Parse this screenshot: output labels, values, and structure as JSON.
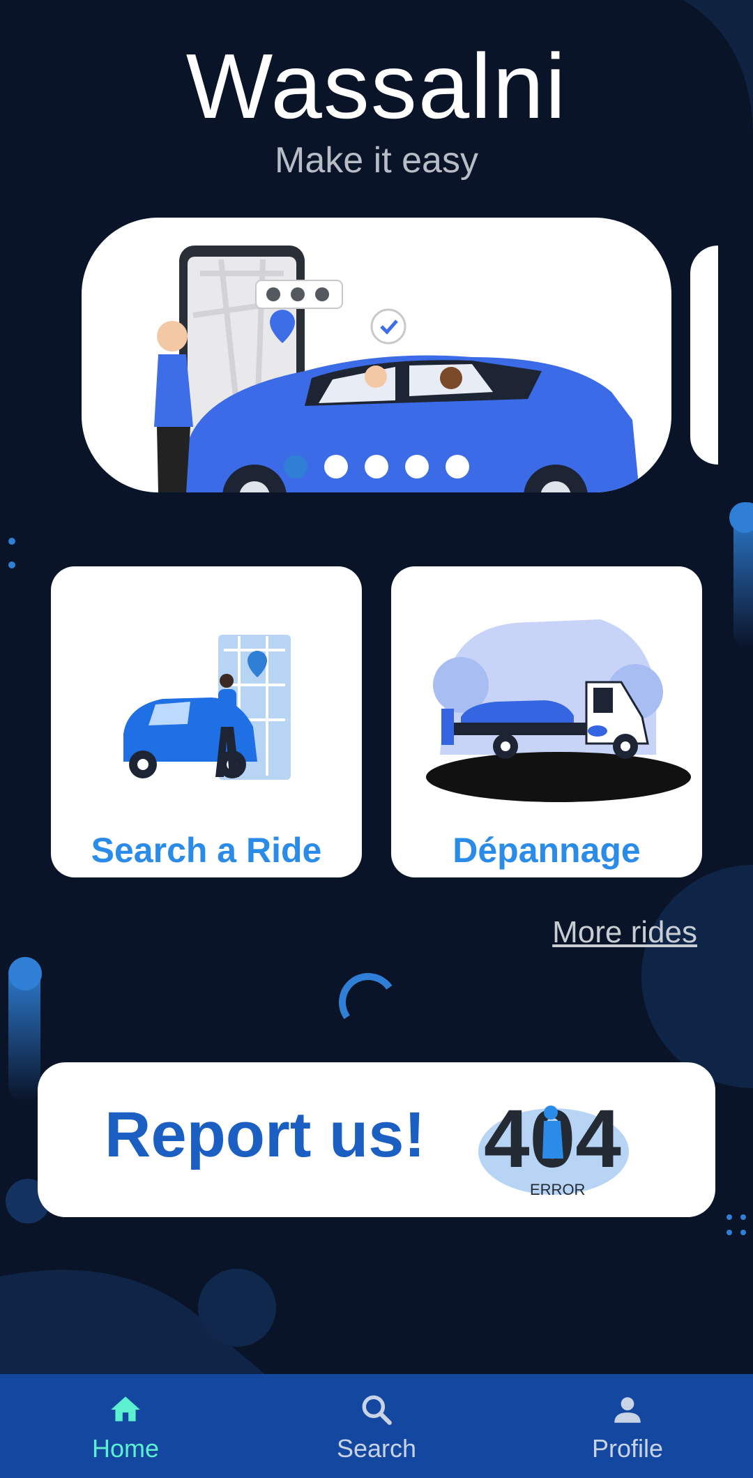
{
  "app": {
    "title": "Wassalni",
    "subtitle": "Make it easy"
  },
  "carousel": {
    "slide_count": 5,
    "active_index": 0
  },
  "services": [
    {
      "label": "Search a Ride"
    },
    {
      "label": "Dépannage"
    }
  ],
  "more_link": "More rides",
  "report": {
    "label": "Report us!",
    "badge_number": "404",
    "badge_text": "ERROR"
  },
  "nav": {
    "home": "Home",
    "search": "Search",
    "profile": "Profile"
  },
  "colors": {
    "background": "#0a1428",
    "accent": "#2b8be8",
    "nav_bar": "#1347a0",
    "nav_active": "#5cf0d0"
  }
}
